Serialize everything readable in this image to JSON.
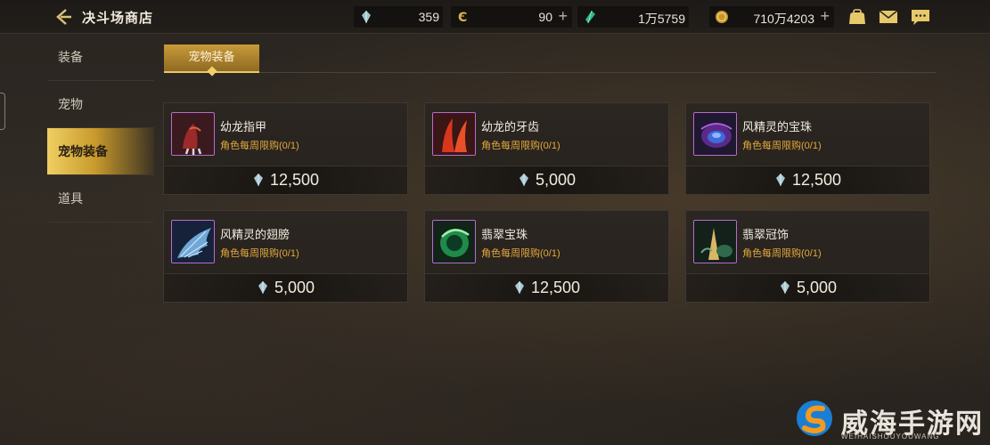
{
  "header": {
    "title": "决斗场商店",
    "currencies": [
      {
        "value": "359",
        "icon": "crystal-icon",
        "plus": ""
      },
      {
        "value": "90",
        "icon": "coin-c-icon",
        "plus": "+"
      },
      {
        "value": "1万5759",
        "icon": "green-gem-icon",
        "plus": ""
      },
      {
        "value": "710万4203",
        "icon": "gold-coin-icon",
        "plus": "+"
      }
    ]
  },
  "sidebar": {
    "items": [
      {
        "label": "装备"
      },
      {
        "label": "宠物"
      },
      {
        "label": "宠物装备"
      },
      {
        "label": "道具"
      }
    ]
  },
  "subtab": {
    "label": "宠物装备"
  },
  "items": [
    {
      "name": "幼龙指甲",
      "limit": "角色每周限购(0/1)",
      "price": "12,500",
      "icon": "dragon-claw-icon"
    },
    {
      "name": "幼龙的牙齿",
      "limit": "角色每周限购(0/1)",
      "price": "5,000",
      "icon": "dragon-tooth-icon"
    },
    {
      "name": "风精灵的宝珠",
      "limit": "角色每周限购(0/1)",
      "price": "12,500",
      "icon": "wind-orb-icon"
    },
    {
      "name": "风精灵的翅膀",
      "limit": "角色每周限购(0/1)",
      "price": "5,000",
      "icon": "wind-wing-icon"
    },
    {
      "name": "翡翠宝珠",
      "limit": "角色每周限购(0/1)",
      "price": "12,500",
      "icon": "jade-orb-icon"
    },
    {
      "name": "翡翠冠饰",
      "limit": "角色每周限购(0/1)",
      "price": "5,000",
      "icon": "jade-crown-icon"
    }
  ],
  "watermark": {
    "text": "威海手游网",
    "sub": "WEIHAISHOUYOUWANG"
  },
  "colors": {
    "accent": "#e3a93c",
    "active": "#f0cf62",
    "rarity_border": "#b86bd0"
  }
}
